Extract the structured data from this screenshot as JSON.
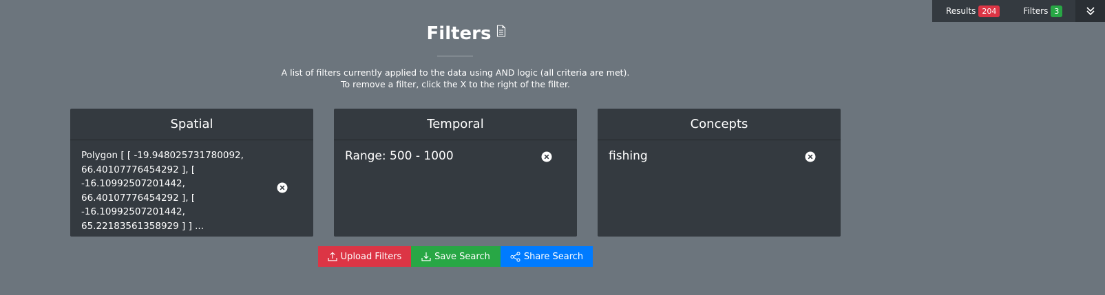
{
  "topbar": {
    "results_label": "Results",
    "results_count": "204",
    "filters_label": "Filters",
    "filters_count": "3",
    "toggle_icon": "double-chevron-down-icon"
  },
  "header": {
    "title": "Filters",
    "title_icon": "document-icon",
    "description_line1": "A list of filters currently applied to the data using AND logic (all criteria are met).",
    "description_line2": "To remove a filter, click the X to the right of the filter."
  },
  "filters": [
    {
      "heading": "Spatial",
      "lines": [
        "Polygon [ [ -19.948025731780092,",
        "66.40107776454292 ], [",
        "-16.10992507201442,",
        "66.40107776454292 ], [",
        "-16.10992507201442,",
        "65.22183561358929 ] ] ..."
      ]
    },
    {
      "heading": "Temporal",
      "value": "Range: 500 - 1000"
    },
    {
      "heading": "Concepts",
      "value": "fishing"
    }
  ],
  "actions": {
    "upload_label": "Upload Filters",
    "save_label": "Save Search",
    "share_label": "Share Search"
  },
  "colors": {
    "background": "#6c757d",
    "panel": "#343a40",
    "results_badge": "#dc3545",
    "filters_badge": "#28a745",
    "upload": "#dc3545",
    "save": "#28a745",
    "share": "#007bff"
  }
}
